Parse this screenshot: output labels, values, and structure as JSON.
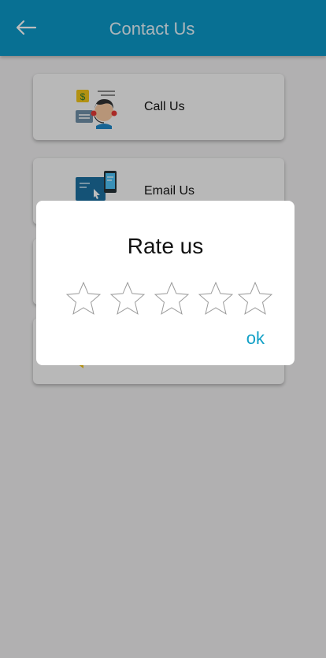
{
  "header": {
    "title": "Contact Us",
    "back_icon": "arrow-left-icon",
    "background_color": "#0b97c7"
  },
  "cards": [
    {
      "label": "Call Us",
      "icon": "customer-support-icon"
    },
    {
      "label": "Email Us",
      "icon": "email-laptop-icon"
    }
  ],
  "dialog": {
    "title": "Rate us",
    "rating": 0,
    "max_rating": 5,
    "ok_label": "ok",
    "accent_color": "#12a0c6"
  }
}
